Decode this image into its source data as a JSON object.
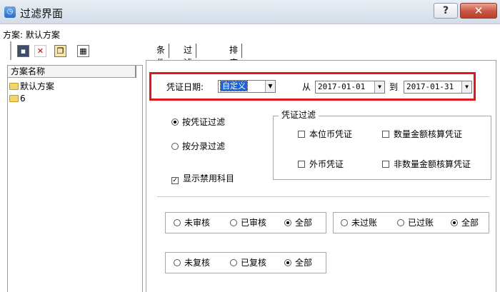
{
  "window": {
    "title": "过滤界面",
    "help_label": "?",
    "close_label": "✕",
    "app_icon": "app-icon"
  },
  "left_panel": {
    "plan_label": "方案: 默认方案",
    "toolbar": {
      "icons": [
        "save-icon",
        "delete-icon",
        "copy-icon",
        "grid-icon"
      ],
      "delete_glyph": "✕"
    },
    "tree": {
      "header": "方案名称",
      "items": [
        {
          "label": "默认方案",
          "icon": "folder-icon"
        },
        {
          "label": "6",
          "icon": "folder-icon"
        }
      ]
    }
  },
  "tabs": [
    {
      "label": "条件",
      "active": true
    },
    {
      "label": "过滤条件",
      "active": false
    },
    {
      "label": "排序",
      "active": false
    }
  ],
  "date_filter": {
    "label": "凭证日期:",
    "type_value": "自定义",
    "from_label": "从",
    "from_value": "2017-01-01",
    "to_label": "到",
    "to_value": "2017-01-31",
    "highlight_color": "#e3161b"
  },
  "filter_mode": {
    "options": [
      {
        "label": "按凭证过滤",
        "selected": true
      },
      {
        "label": "按分录过滤",
        "selected": false
      }
    ]
  },
  "show_disabled_accounts": {
    "label": "显示禁用科目",
    "checked": true
  },
  "voucher_filter": {
    "title": "凭证过滤",
    "options": [
      {
        "label": "本位币凭证",
        "checked": false
      },
      {
        "label": "数量金额核算凭证",
        "checked": false
      },
      {
        "label": "外币凭证",
        "checked": false
      },
      {
        "label": "非数量金额核算凭证",
        "checked": false
      }
    ]
  },
  "audit_status": {
    "options": [
      {
        "label": "未审核",
        "selected": false
      },
      {
        "label": "已审核",
        "selected": false
      },
      {
        "label": "全部",
        "selected": true
      }
    ]
  },
  "posting_status": {
    "options": [
      {
        "label": "未过账",
        "selected": false
      },
      {
        "label": "已过账",
        "selected": false
      },
      {
        "label": "全部",
        "selected": true
      }
    ]
  },
  "review_status": {
    "options": [
      {
        "label": "未复核",
        "selected": false
      },
      {
        "label": "已复核",
        "selected": false
      },
      {
        "label": "全部",
        "selected": true
      }
    ]
  },
  "colors": {
    "title_bar": "#d3dce8",
    "close_button": "#c8553f",
    "selection": "#1a62d6"
  }
}
